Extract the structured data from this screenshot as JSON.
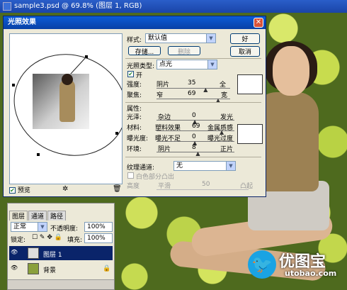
{
  "document": {
    "title": "sample3.psd @ 69.8% (图层 1, RGB)"
  },
  "dialog": {
    "title": "光照效果",
    "style_label": "样式:",
    "style_value": "默认值",
    "save_label": "存储...",
    "delete_label": "删除",
    "ok_label": "好",
    "cancel_label": "取消",
    "light_type_label": "光照类型:",
    "light_type_value": "点光",
    "on_label": "开",
    "intensity": {
      "label": "强度:",
      "left": "阴片",
      "value": "35",
      "right": "全",
      "fraction": 0.675
    },
    "focus": {
      "label": "聚焦:",
      "left": "窄",
      "value": "69",
      "right": "宽",
      "fraction": 0.845
    },
    "properties_label": "属性:",
    "gloss": {
      "label": "光泽:",
      "left": "杂边",
      "value": "0",
      "right": "发光",
      "fraction": 0.5
    },
    "material": {
      "label": "材料:",
      "left": "塑料效果",
      "value": "69",
      "right": "金属质感",
      "fraction": 0.845
    },
    "exposure": {
      "label": "曝光度:",
      "left": "曝光不足",
      "value": "0",
      "right": "曝光过度",
      "fraction": 0.5
    },
    "ambience": {
      "label": "环境:",
      "left": "阴片",
      "value": "8",
      "right": "正片",
      "fraction": 0.54
    },
    "texture_label": "纹理通道:",
    "texture_value": "无",
    "white_high_label": "白色部分凸出",
    "height": {
      "label": "高度",
      "left": "平滑",
      "value": "50",
      "right": "凸起"
    },
    "preview_label": "预览"
  },
  "layers_panel": {
    "tabs": [
      "图层",
      "通道",
      "路径"
    ],
    "blend_mode": "正常",
    "opacity_label": "不透明度:",
    "opacity_value": "100%",
    "lock_label": "锁定:",
    "fill_label": "填充:",
    "fill_value": "100%",
    "rows": [
      {
        "name": "图层 1"
      },
      {
        "name": "背景"
      }
    ]
  },
  "watermark": {
    "text": "优图宝",
    "url": "utobao.com"
  }
}
